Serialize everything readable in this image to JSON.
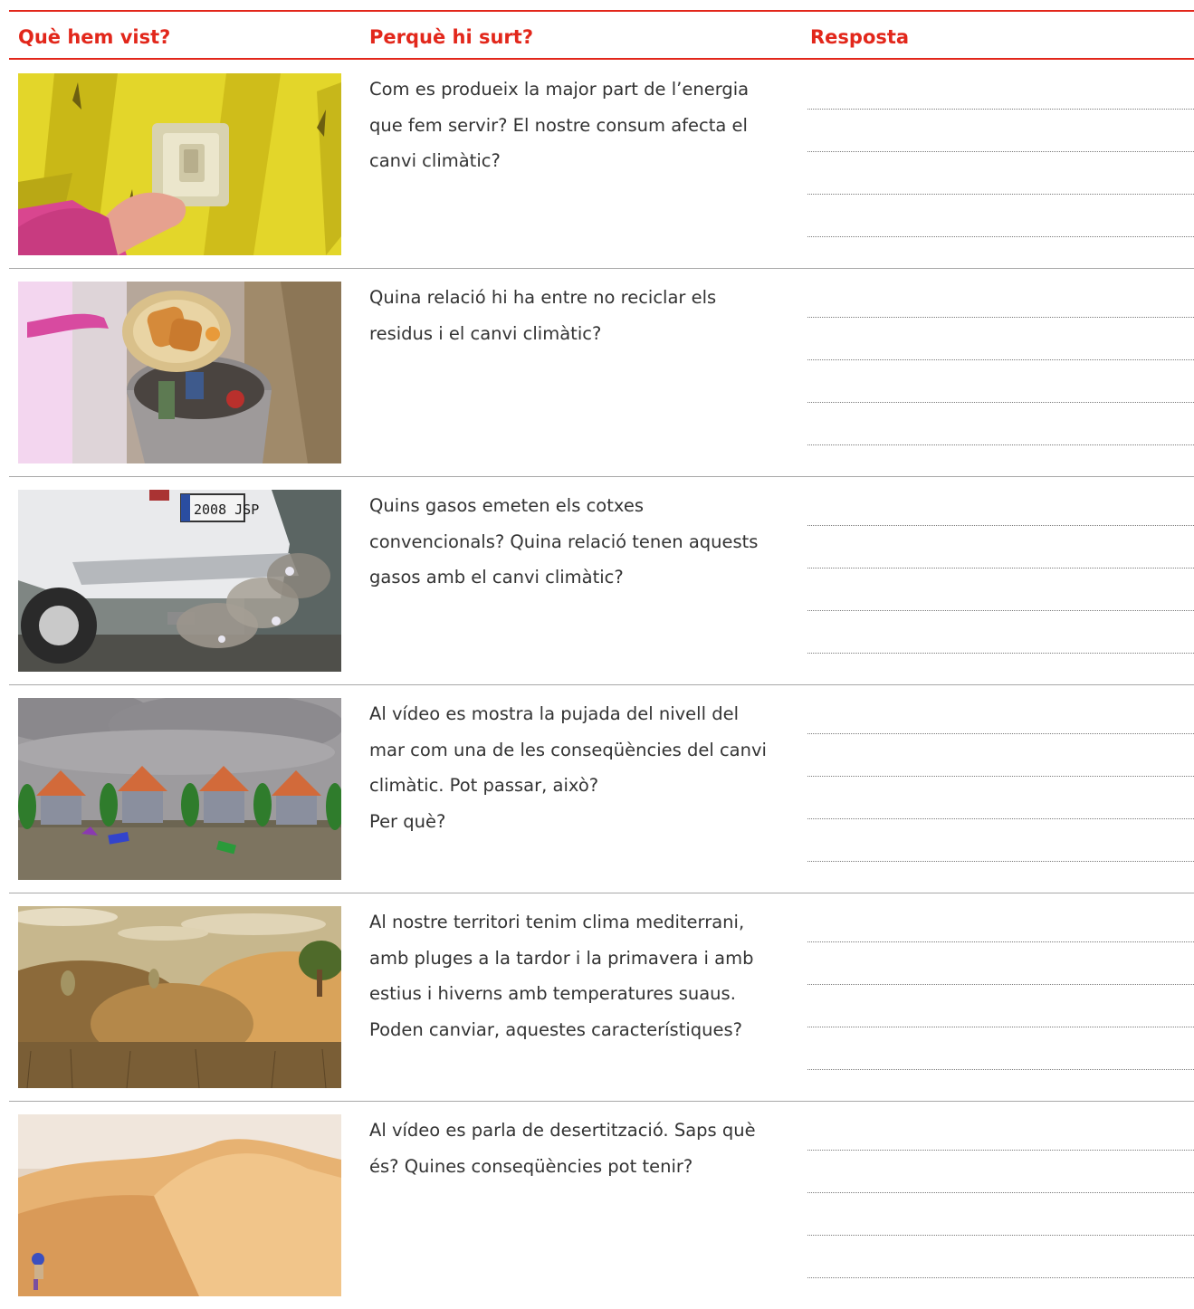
{
  "headers": {
    "seen": "Què hem vist?",
    "why": "Perquè hi surt?",
    "answer": "Resposta"
  },
  "rows": [
    {
      "image": "light-switch-hand-scene",
      "question": "Com es produeix la major part de l’energia\nque fem servir? El nostre consum afecta el\ncanvi climàtic?"
    },
    {
      "image": "trash-bin-plate-scene",
      "question": "Quina relació hi ha entre no reciclar els\nresidus i el canvi climàtic?"
    },
    {
      "image": "car-exhaust-scene",
      "question": "Quins gasos emeten els cotxes\nconvencionals? Quina relació tenen aquests\ngasos amb el canvi climàtic?",
      "plate": "2008 JSP"
    },
    {
      "image": "flooded-houses-scene",
      "question": "Al vídeo es mostra la pujada del nivell del\nmar com una de les conseqüències del canvi\nclimàtic. Pot passar, això?\nPer què?"
    },
    {
      "image": "dry-hills-scene",
      "question": "Al nostre territori tenim clima mediterrani,\namb pluges a la tardor i la primavera i amb\nestius i hiverns amb temperatures suaus.\nPoden canviar, aquestes característiques?"
    },
    {
      "image": "desert-dunes-scene",
      "question": "Al vídeo es parla de desertització. Saps què\nés? Quines conseqüències pot tenir?"
    }
  ],
  "colors": {
    "accent": "#e2271b",
    "text": "#333333",
    "separator": "#a8a8a8"
  }
}
